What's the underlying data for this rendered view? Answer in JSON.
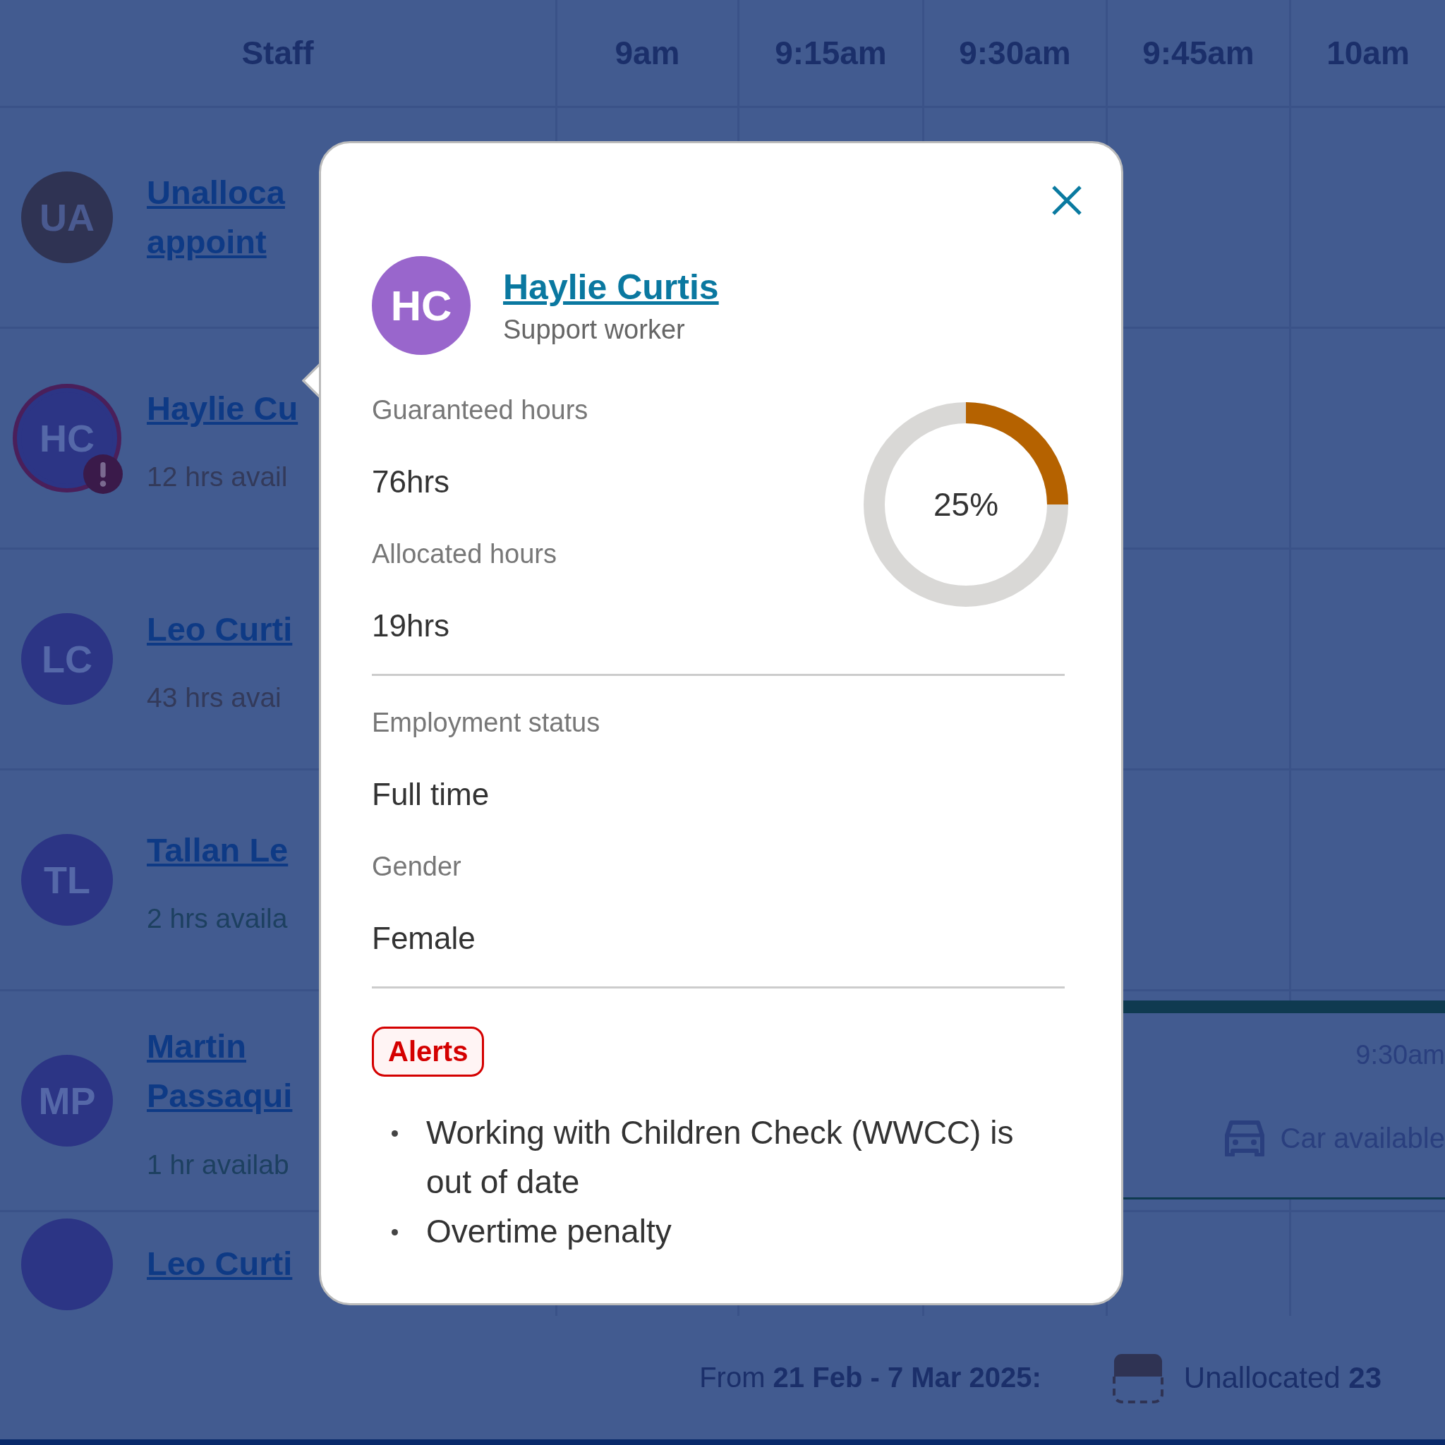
{
  "header": {
    "staff_label": "Staff",
    "times": [
      "9am",
      "9:15am",
      "9:30am",
      "9:45am",
      "10am"
    ]
  },
  "staff": [
    {
      "kind": "unallocated",
      "initials": "UA",
      "name": "Unalloca appoint"
    },
    {
      "kind": "alert",
      "initials": "HC",
      "name": "Haylie Cu",
      "availability": "12 hrs avail",
      "color": "#333a5a"
    },
    {
      "kind": "staff",
      "initials": "LC",
      "name": "Leo Curti",
      "availability": "43 hrs avai",
      "color": "#333a5a"
    },
    {
      "kind": "staff",
      "initials": "TL",
      "name": "Tallan Le",
      "availability": "2 hrs availa",
      "color": "#1d4060"
    },
    {
      "kind": "staff",
      "initials": "MP",
      "name": "Martin Passaqui",
      "availability": "1 hr availab",
      "color": "#1d4060"
    },
    {
      "kind": "staff",
      "name": "Leo Curti"
    }
  ],
  "booking": {
    "time": "9:30am",
    "note": "Car available"
  },
  "popup": {
    "initials": "HC",
    "name": "Haylie Curtis",
    "role": "Support worker",
    "fields": [
      {
        "label": "Guaranteed hours",
        "value": "76hrs"
      },
      {
        "label": "Allocated hours",
        "value": "19hrs"
      }
    ],
    "usage": {
      "level": 0.25,
      "reading": "25%"
    },
    "details": [
      {
        "label": "Employment status",
        "value": "Full time"
      },
      {
        "label": "Gender",
        "value": "Female"
      }
    ],
    "alerts_label": "Alerts",
    "alerts": [
      "Working with Children Check (WWCC) is out of date",
      "Overtime penalty"
    ]
  },
  "footer": {
    "range": "From **21 Feb - 7 Mar 2025:**",
    "unallocated": "Unallocated **23**"
  }
}
